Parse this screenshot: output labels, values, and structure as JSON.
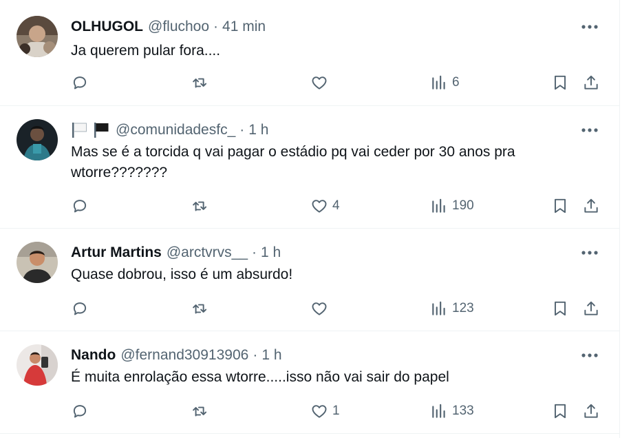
{
  "tweets": [
    {
      "name": "OLHUGOL",
      "handle": "@fluchoo",
      "dot": "·",
      "time": "41 min",
      "text": "Ja querem pular fora....",
      "likes": "",
      "views": "6",
      "has_flags": false
    },
    {
      "name": "",
      "handle": "@comunidadesfc_",
      "dot": "·",
      "time": "1 h",
      "text": "Mas se é a torcida q vai pagar o estádio pq vai ceder por 30 anos pra wtorre???????",
      "likes": "4",
      "views": "190",
      "has_flags": true,
      "flags": [
        "white-flag-icon",
        "black-flag-icon"
      ]
    },
    {
      "name": "Artur Martins",
      "handle": "@arctvrvs__",
      "dot": "·",
      "time": "1 h",
      "text": "Quase dobrou, isso é um absurdo!",
      "likes": "",
      "views": "123",
      "has_flags": false
    },
    {
      "name": "Nando",
      "handle": "@fernand30913906",
      "dot": "·",
      "time": "1 h",
      "text": "É muita enrolação essa wtorre.....isso não vai sair do papel",
      "likes": "1",
      "views": "133",
      "has_flags": false
    }
  ],
  "colors": {
    "text_primary": "#0f1419",
    "text_secondary": "#536471",
    "divider": "#eff3f4"
  }
}
